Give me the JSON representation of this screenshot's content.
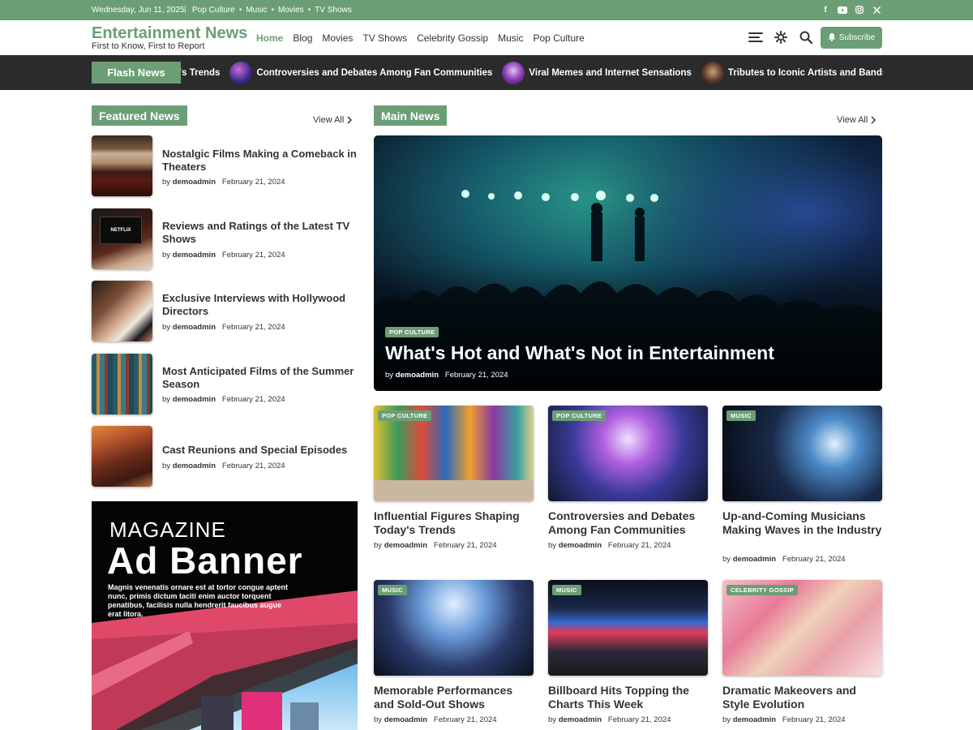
{
  "topbar": {
    "date": "Wednesday, Jun 11, 2025",
    "links": [
      "Pop Culture",
      "Movies",
      "TV Shows"
    ],
    "music_link": "Music",
    "social_icons": [
      "facebook-icon",
      "youtube-icon",
      "instagram-icon",
      "x-icon"
    ]
  },
  "header": {
    "site_title": "Entertainment News",
    "tagline": "First to Know, First to Report",
    "nav": [
      "Home",
      "Blog",
      "Movies",
      "TV Shows",
      "Celebrity Gossip",
      "Music",
      "Pop Culture"
    ],
    "subscribe_label": "Subscribe",
    "icons": [
      "menu-icon",
      "theme-toggle-icon",
      "search-icon",
      "bell-icon"
    ]
  },
  "flash": {
    "label": "Flash News",
    "items": [
      "y's Trends",
      "Controversies and Debates Among Fan Communities",
      "Viral Memes and Internet Sensations",
      "Tributes to Iconic Artists and Bands"
    ]
  },
  "featured": {
    "heading": "Featured News",
    "view_all": "View All",
    "items": [
      {
        "title": "Nostalgic Films Making a Comeback in Theaters",
        "author": "demoadmin",
        "date": "February 21, 2024"
      },
      {
        "title": "Reviews and Ratings of the Latest TV Shows",
        "author": "demoadmin",
        "date": "February 21, 2024"
      },
      {
        "title": "Exclusive Interviews with Hollywood Directors",
        "author": "demoadmin",
        "date": "February 21, 2024"
      },
      {
        "title": "Most Anticipated Films of the Summer Season",
        "author": "demoadmin",
        "date": "February 21, 2024"
      },
      {
        "title": "Cast Reunions and Special Episodes",
        "author": "demoadmin",
        "date": "February 21, 2024"
      }
    ],
    "netflix_text": "NETFLIX"
  },
  "ad": {
    "line1": "MAGAZINE",
    "line2": "Ad Banner",
    "body": "Magnis venenatis ornare est at tortor congue aptent nunc, primis dictum taciti enim auctor torquent penatibus, facilisis nulla hendrerit faucibus augue erat litora."
  },
  "main": {
    "heading": "Main News",
    "view_all": "View All",
    "by": "by",
    "hero": {
      "category": "POP CULTURE",
      "title": "What's Hot and What's Not in Entertainment",
      "author": "demoadmin",
      "date": "February 21, 2024"
    },
    "cards": [
      {
        "category": "POP CULTURE",
        "title": "Influential Figures Shaping Today's Trends",
        "author": "demoadmin",
        "date": "February 21, 2024"
      },
      {
        "category": "POP CULTURE",
        "title": "Controversies and Debates Among Fan Communities",
        "author": "demoadmin",
        "date": "February 21, 2024"
      },
      {
        "category": "MUSIC",
        "title": "Up-and-Coming Musicians Making Waves in the Industry",
        "author": "demoadmin",
        "date": "February 21, 2024"
      },
      {
        "category": "MUSIC",
        "title": "Memorable Performances and Sold-Out Shows",
        "author": "demoadmin",
        "date": "February 21, 2024"
      },
      {
        "category": "MUSIC",
        "title": "Billboard Hits Topping the Charts This Week",
        "author": "demoadmin",
        "date": "February 21, 2024"
      },
      {
        "category": "CELEBRITY GOSSIP",
        "title": "Dramatic Makeovers and Style Evolution",
        "author": "demoadmin",
        "date": "February 21, 2024"
      }
    ]
  },
  "colors": {
    "accent": "#6c9e76",
    "dark_bar": "#2b2b2b",
    "text": "#333333"
  }
}
